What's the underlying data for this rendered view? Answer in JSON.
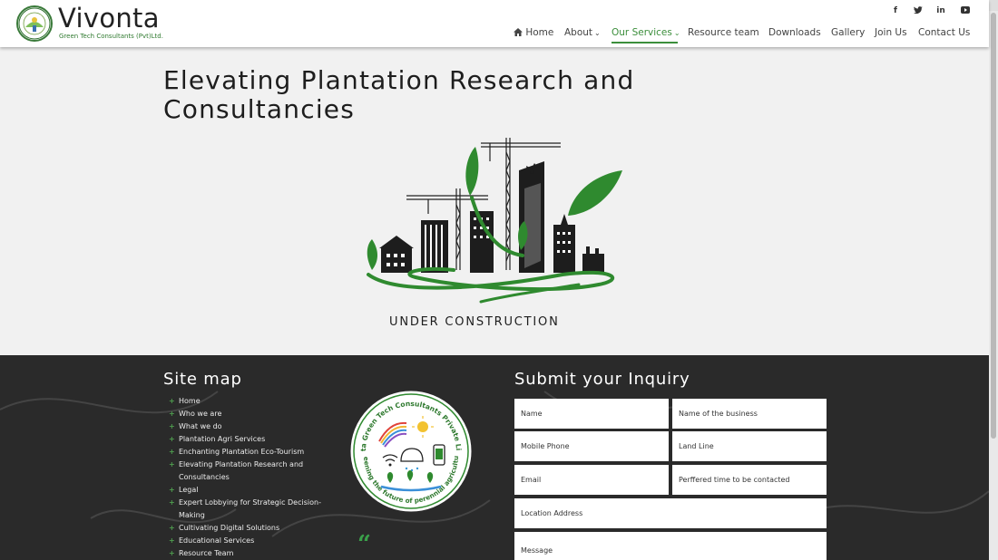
{
  "brand": {
    "name": "Vivonta",
    "tagline": "Green Tech Consultants (Pvt)Ltd."
  },
  "social": [
    "f",
    "t",
    "in",
    "yt"
  ],
  "nav": {
    "home": "Home",
    "about": "About",
    "services": "Our Services",
    "resource": "Resource team",
    "downloads": "Downloads",
    "gallery": "Gallery",
    "join": "Join Us",
    "contact": "Contact Us"
  },
  "hero": {
    "title": "Elevating Plantation Research and Consultancies",
    "status": "UNDER CONSTRUCTION"
  },
  "footer": {
    "sitemap_title": "Site map",
    "sitemap": [
      "Home",
      "Who we are",
      "What we do",
      "Plantation Agri Services",
      "Enchanting Plantation Eco-Tourism",
      "Elevating Plantation Research and Consultancies",
      "Legal",
      "Expert Lobbying for Strategic Decision-Making",
      "Cultivating Digital Solutions",
      "Educational Services",
      "Resource Team"
    ],
    "seal_text_top": "Vivonta Green Tech Consultants Private Limited",
    "seal_text_bottom": "Greening the future of perennial agriculture",
    "inquiry_title": "Submit your Inquiry",
    "form": {
      "name": "Name",
      "business": "Name of the business",
      "mobile": "Mobile Phone",
      "landline": "Land Line",
      "email": "Email",
      "preferred_time": "Perffered time to be contacted",
      "location": "Location Address",
      "message": "Message"
    }
  },
  "colors": {
    "accent": "#3b8e3b",
    "footer_bg": "#2a2a2a",
    "hero_bg": "#f1f1f1"
  }
}
